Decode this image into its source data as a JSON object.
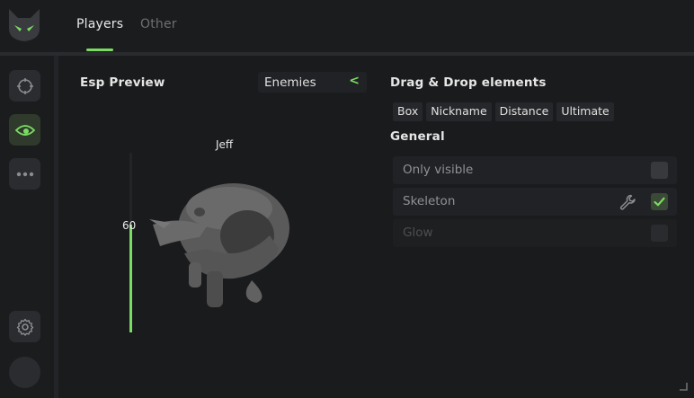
{
  "header": {
    "logo_icon": "cat-face-logo",
    "tabs": [
      {
        "label": "Players",
        "active": true
      },
      {
        "label": "Other",
        "active": false
      }
    ],
    "accent": "#7bdc63"
  },
  "sidebar": {
    "items": [
      {
        "icon": "crosshair-icon",
        "active": false
      },
      {
        "icon": "eye-icon",
        "active": true
      },
      {
        "icon": "more-dots-icon",
        "active": false
      },
      {
        "icon": "gear-icon",
        "active": false
      },
      {
        "icon": "avatar",
        "active": false
      }
    ]
  },
  "preview": {
    "title": "Esp Preview",
    "filter": {
      "selected": "Enemies",
      "chevron": "<"
    },
    "player_name": "Jeff",
    "health": {
      "value": "60",
      "fraction": 0.6
    }
  },
  "elements": {
    "title": "Drag & Drop elements",
    "chips": [
      "Box",
      "Nickname",
      "Distance",
      "Ultimate"
    ]
  },
  "general": {
    "title": "General",
    "options": [
      {
        "label": "Only visible",
        "checked": false,
        "disabled": false,
        "has_settings": false
      },
      {
        "label": "Skeleton",
        "checked": true,
        "disabled": false,
        "has_settings": true
      },
      {
        "label": "Glow",
        "checked": false,
        "disabled": true,
        "has_settings": false
      }
    ]
  }
}
